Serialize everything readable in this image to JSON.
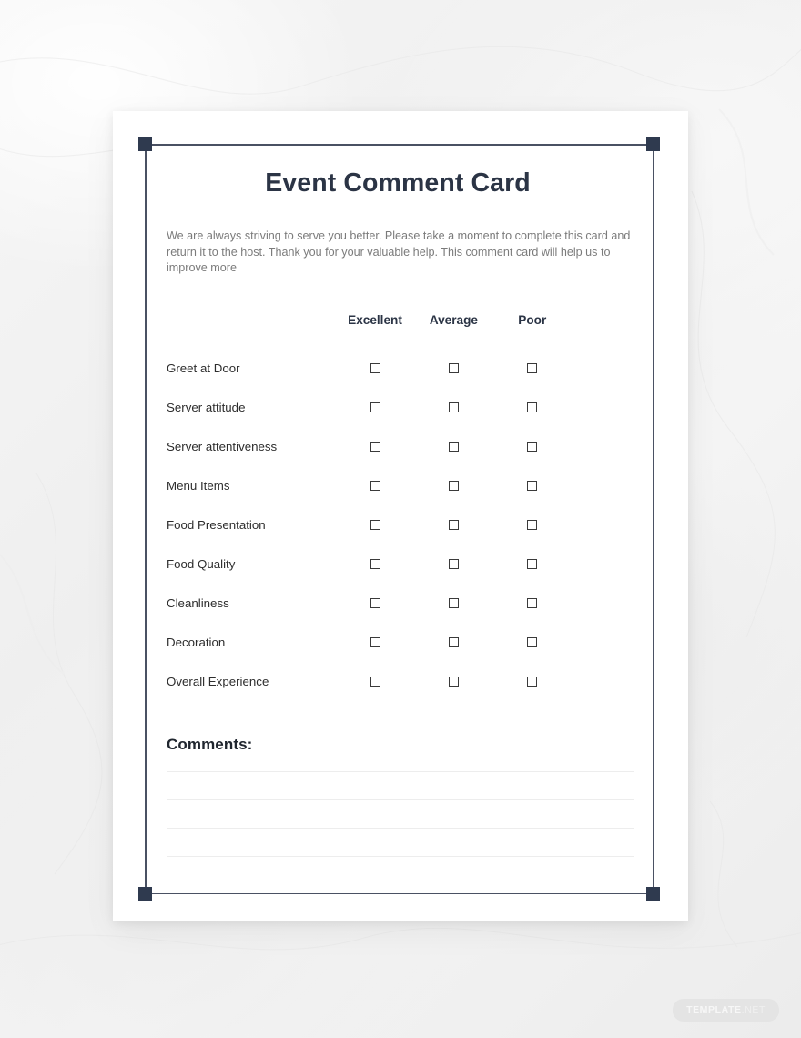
{
  "document": {
    "title": "Event Comment Card",
    "intro": "We are always striving to serve you better. Please take a moment to complete this card and return it to the host. Thank you for your valuable help. This comment card will help us to improve more"
  },
  "rating_table": {
    "label_column_header": "",
    "option_headers": [
      "Excellent",
      "Average",
      "Poor"
    ],
    "rows": [
      {
        "label": "Greet at Door"
      },
      {
        "label": "Server attitude"
      },
      {
        "label": "Server attentiveness"
      },
      {
        "label": "Menu Items"
      },
      {
        "label": "Food Presentation"
      },
      {
        "label": "Food Quality"
      },
      {
        "label": "Cleanliness"
      },
      {
        "label": "Decoration"
      },
      {
        "label": "Overall Experience"
      }
    ]
  },
  "comments": {
    "heading": "Comments:",
    "line_count": 4,
    "value": ""
  },
  "watermark": {
    "text_strong": "TEMPLATE",
    "text_dim": ".NET"
  },
  "colors": {
    "title": "#2b3445",
    "body_text": "#7b7b7b",
    "frame_line": "#4a5163",
    "corner_square": "#2f3a4f",
    "checkbox_border": "#3a3a3a",
    "comment_rule": "#ededed",
    "paper": "#ffffff",
    "backdrop": "#f2f2f2"
  }
}
